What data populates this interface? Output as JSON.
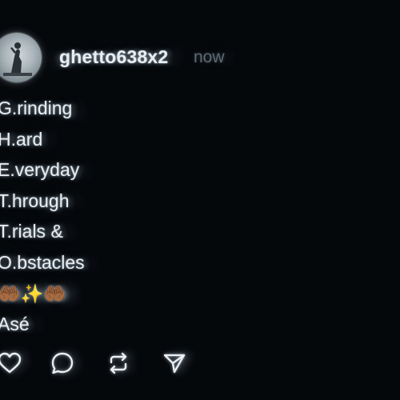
{
  "post": {
    "username": "ghetto638x2",
    "timestamp": "now",
    "lines": [
      "G.rinding",
      "H.ard",
      "E.veryday",
      "T.hrough",
      "T.rials &",
      "O.bstacles",
      "🤲🏾✨🤲🏾",
      "Asé"
    ]
  },
  "actions": {
    "like_icon": "heart-icon",
    "reply_icon": "comment-bubble-icon",
    "repost_icon": "repost-icon",
    "share_icon": "send-icon"
  },
  "colors": {
    "background": "#05080b",
    "text": "#e8eef3",
    "muted": "#5c6a74"
  }
}
